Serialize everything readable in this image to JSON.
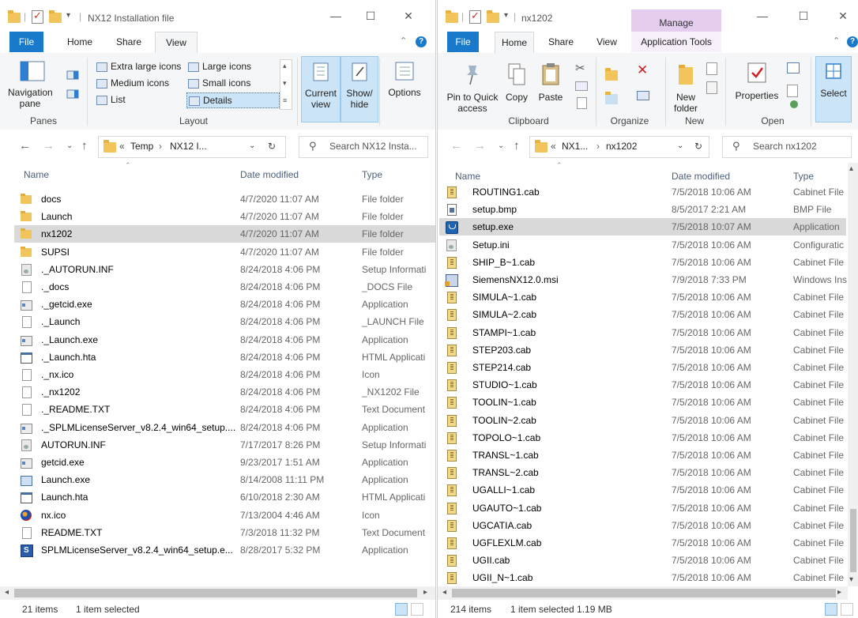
{
  "left": {
    "title": "NX12 Installation file",
    "tabs": {
      "file": "File",
      "home": "Home",
      "share": "Share",
      "view": "View"
    },
    "ribbon": {
      "nav_pane": "Navigation pane",
      "panes_group": "Panes",
      "layout_group": "Layout",
      "layout_items": [
        "Extra large icons",
        "Large icons",
        "Medium icons",
        "Small icons",
        "List",
        "Details"
      ],
      "current_view": "Current view",
      "show_hide": "Show/ hide",
      "options": "Options"
    },
    "address": {
      "crumb1": "Temp",
      "crumb2": "NX12 I..."
    },
    "search_placeholder": "Search NX12 Insta...",
    "columns": {
      "name": "Name",
      "date": "Date modified",
      "type": "Type"
    },
    "files": [
      {
        "name": "docs",
        "date": "4/7/2020 11:07 AM",
        "type": "File folder",
        "icon": "folder"
      },
      {
        "name": "Launch",
        "date": "4/7/2020 11:07 AM",
        "type": "File folder",
        "icon": "folder"
      },
      {
        "name": "nx1202",
        "date": "4/7/2020 11:07 AM",
        "type": "File folder",
        "icon": "folder",
        "selected": true
      },
      {
        "name": "SUPSI",
        "date": "4/7/2020 11:07 AM",
        "type": "File folder",
        "icon": "folder"
      },
      {
        "name": "._AUTORUN.INF",
        "date": "8/24/2018 4:06 PM",
        "type": "Setup Informati",
        "icon": "ini"
      },
      {
        "name": "._docs",
        "date": "8/24/2018 4:06 PM",
        "type": "_DOCS File",
        "icon": "file"
      },
      {
        "name": "._getcid.exe",
        "date": "8/24/2018 4:06 PM",
        "type": "Application",
        "icon": "app"
      },
      {
        "name": "._Launch",
        "date": "8/24/2018 4:06 PM",
        "type": "_LAUNCH File",
        "icon": "file"
      },
      {
        "name": "._Launch.exe",
        "date": "8/24/2018 4:06 PM",
        "type": "Application",
        "icon": "app"
      },
      {
        "name": "._Launch.hta",
        "date": "8/24/2018 4:06 PM",
        "type": "HTML Applicati",
        "icon": "hta"
      },
      {
        "name": "._nx.ico",
        "date": "8/24/2018 4:06 PM",
        "type": "Icon",
        "icon": "file"
      },
      {
        "name": "._nx1202",
        "date": "8/24/2018 4:06 PM",
        "type": "_NX1202 File",
        "icon": "file"
      },
      {
        "name": "._README.TXT",
        "date": "8/24/2018 4:06 PM",
        "type": "Text Document",
        "icon": "file"
      },
      {
        "name": "._SPLMLicenseServer_v8.2.4_win64_setup....",
        "date": "8/24/2018 4:06 PM",
        "type": "Application",
        "icon": "app"
      },
      {
        "name": "AUTORUN.INF",
        "date": "7/17/2017 8:26 PM",
        "type": "Setup Informati",
        "icon": "ini"
      },
      {
        "name": "getcid.exe",
        "date": "9/23/2017 1:51 AM",
        "type": "Application",
        "icon": "app"
      },
      {
        "name": "Launch.exe",
        "date": "8/14/2008 11:11 PM",
        "type": "Application",
        "icon": "launch"
      },
      {
        "name": "Launch.hta",
        "date": "6/10/2018 2:30 AM",
        "type": "HTML Applicati",
        "icon": "hta"
      },
      {
        "name": "nx.ico",
        "date": "7/13/2004 4:46 AM",
        "type": "Icon",
        "icon": "nx"
      },
      {
        "name": "README.TXT",
        "date": "7/3/2018 11:32 PM",
        "type": "Text Document",
        "icon": "file"
      },
      {
        "name": "SPLMLicenseServer_v8.2.4_win64_setup.e...",
        "date": "8/28/2017 5:32 PM",
        "type": "Application",
        "icon": "splm"
      }
    ],
    "status": {
      "count": "21 items",
      "selected": "1 item selected"
    }
  },
  "right": {
    "title": "nx1202",
    "manage": "Manage",
    "tabs": {
      "file": "File",
      "home": "Home",
      "share": "Share",
      "view": "View",
      "app_tools": "Application Tools"
    },
    "ribbon": {
      "pin": "Pin to Quick access",
      "copy": "Copy",
      "paste": "Paste",
      "new_folder": "New folder",
      "properties": "Properties",
      "select": "Select",
      "groups": {
        "clipboard": "Clipboard",
        "organize": "Organize",
        "new": "New",
        "open": "Open"
      }
    },
    "address": {
      "crumb1": "NX1...",
      "crumb2": "nx1202"
    },
    "search_placeholder": "Search nx1202",
    "columns": {
      "name": "Name",
      "date": "Date modified",
      "type": "Type"
    },
    "files": [
      {
        "name": "ROUTING1.cab",
        "date": "7/5/2018 10:06 AM",
        "type": "Cabinet File",
        "icon": "cab"
      },
      {
        "name": "setup.bmp",
        "date": "8/5/2017 2:21 AM",
        "type": "BMP File",
        "icon": "bmp"
      },
      {
        "name": "setup.exe",
        "date": "7/5/2018 10:07 AM",
        "type": "Application",
        "icon": "setupexe",
        "selected": true
      },
      {
        "name": "Setup.ini",
        "date": "7/5/2018 10:06 AM",
        "type": "Configuratic",
        "icon": "ini"
      },
      {
        "name": "SHIP_B~1.cab",
        "date": "7/5/2018 10:06 AM",
        "type": "Cabinet File",
        "icon": "cab"
      },
      {
        "name": "SiemensNX12.0.msi",
        "date": "7/9/2018 7:33 PM",
        "type": "Windows Ins",
        "icon": "msi"
      },
      {
        "name": "SIMULA~1.cab",
        "date": "7/5/2018 10:06 AM",
        "type": "Cabinet File",
        "icon": "cab"
      },
      {
        "name": "SIMULA~2.cab",
        "date": "7/5/2018 10:06 AM",
        "type": "Cabinet File",
        "icon": "cab"
      },
      {
        "name": "STAMPI~1.cab",
        "date": "7/5/2018 10:06 AM",
        "type": "Cabinet File",
        "icon": "cab"
      },
      {
        "name": "STEP203.cab",
        "date": "7/5/2018 10:06 AM",
        "type": "Cabinet File",
        "icon": "cab"
      },
      {
        "name": "STEP214.cab",
        "date": "7/5/2018 10:06 AM",
        "type": "Cabinet File",
        "icon": "cab"
      },
      {
        "name": "STUDIO~1.cab",
        "date": "7/5/2018 10:06 AM",
        "type": "Cabinet File",
        "icon": "cab"
      },
      {
        "name": "TOOLIN~1.cab",
        "date": "7/5/2018 10:06 AM",
        "type": "Cabinet File",
        "icon": "cab"
      },
      {
        "name": "TOOLIN~2.cab",
        "date": "7/5/2018 10:06 AM",
        "type": "Cabinet File",
        "icon": "cab"
      },
      {
        "name": "TOPOLO~1.cab",
        "date": "7/5/2018 10:06 AM",
        "type": "Cabinet File",
        "icon": "cab"
      },
      {
        "name": "TRANSL~1.cab",
        "date": "7/5/2018 10:06 AM",
        "type": "Cabinet File",
        "icon": "cab"
      },
      {
        "name": "TRANSL~2.cab",
        "date": "7/5/2018 10:06 AM",
        "type": "Cabinet File",
        "icon": "cab"
      },
      {
        "name": "UGALLI~1.cab",
        "date": "7/5/2018 10:06 AM",
        "type": "Cabinet File",
        "icon": "cab"
      },
      {
        "name": "UGAUTO~1.cab",
        "date": "7/5/2018 10:06 AM",
        "type": "Cabinet File",
        "icon": "cab"
      },
      {
        "name": "UGCATIA.cab",
        "date": "7/5/2018 10:06 AM",
        "type": "Cabinet File",
        "icon": "cab"
      },
      {
        "name": "UGFLEXLM.cab",
        "date": "7/5/2018 10:06 AM",
        "type": "Cabinet File",
        "icon": "cab"
      },
      {
        "name": "UGII.cab",
        "date": "7/5/2018 10:06 AM",
        "type": "Cabinet File",
        "icon": "cab"
      },
      {
        "name": "UGII_N~1.cab",
        "date": "7/5/2018 10:06 AM",
        "type": "Cabinet File",
        "icon": "cab"
      }
    ],
    "status": {
      "count": "214 items",
      "selected": "1 item selected  1.19 MB"
    }
  }
}
